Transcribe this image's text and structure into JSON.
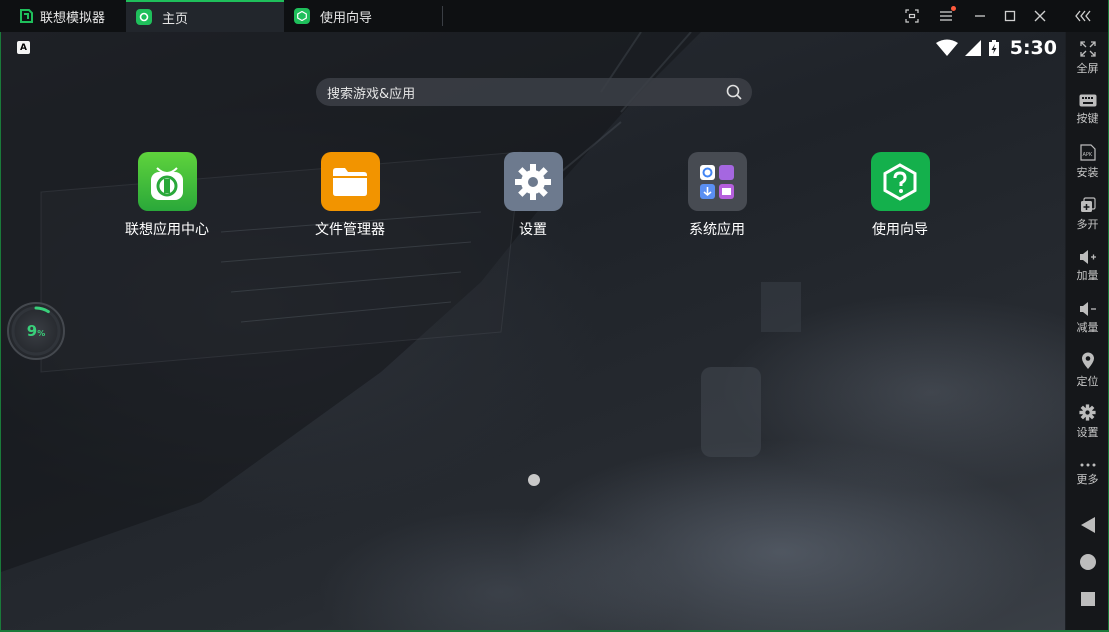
{
  "titlebar": {
    "app_title": "联想模拟器",
    "tabs": [
      {
        "label": "主页",
        "active": true
      },
      {
        "label": "使用向导",
        "active": false
      }
    ],
    "controls": [
      "fullscreen-icon",
      "menu-icon",
      "minimize-icon",
      "maximize-icon",
      "close-icon",
      "collapse-icon"
    ]
  },
  "status": {
    "indicator": "A",
    "time": "5:30"
  },
  "search": {
    "placeholder": "搜索游戏&应用"
  },
  "apps": [
    {
      "label": "联想应用中心",
      "color": "#3fbf3a"
    },
    {
      "label": "文件管理器",
      "color": "#f29400"
    },
    {
      "label": "设置",
      "color": "#6d7a8e"
    },
    {
      "label": "系统应用",
      "color": "#474b52"
    },
    {
      "label": "使用向导",
      "color": "#14b04c"
    }
  ],
  "float_ball": {
    "value": "9",
    "unit": "%",
    "progress": 0.09
  },
  "sidebar": {
    "items": [
      {
        "label": "全屏",
        "icon": "expand-icon"
      },
      {
        "label": "按键",
        "icon": "keyboard-icon"
      },
      {
        "label": "安装",
        "icon": "apk-icon"
      },
      {
        "label": "多开",
        "icon": "multi-instance-icon"
      },
      {
        "label": "加量",
        "icon": "volume-up-icon"
      },
      {
        "label": "减量",
        "icon": "volume-down-icon"
      },
      {
        "label": "定位",
        "icon": "location-icon"
      },
      {
        "label": "设置",
        "icon": "gear-icon"
      },
      {
        "label": "更多",
        "icon": "more-icon"
      }
    ],
    "nav": [
      "back-icon",
      "home-icon",
      "recents-icon"
    ]
  },
  "colors": {
    "accent": "#1fbf5b",
    "titlebar_bg": "#0e1012",
    "sidebar_bg": "#15171a"
  }
}
